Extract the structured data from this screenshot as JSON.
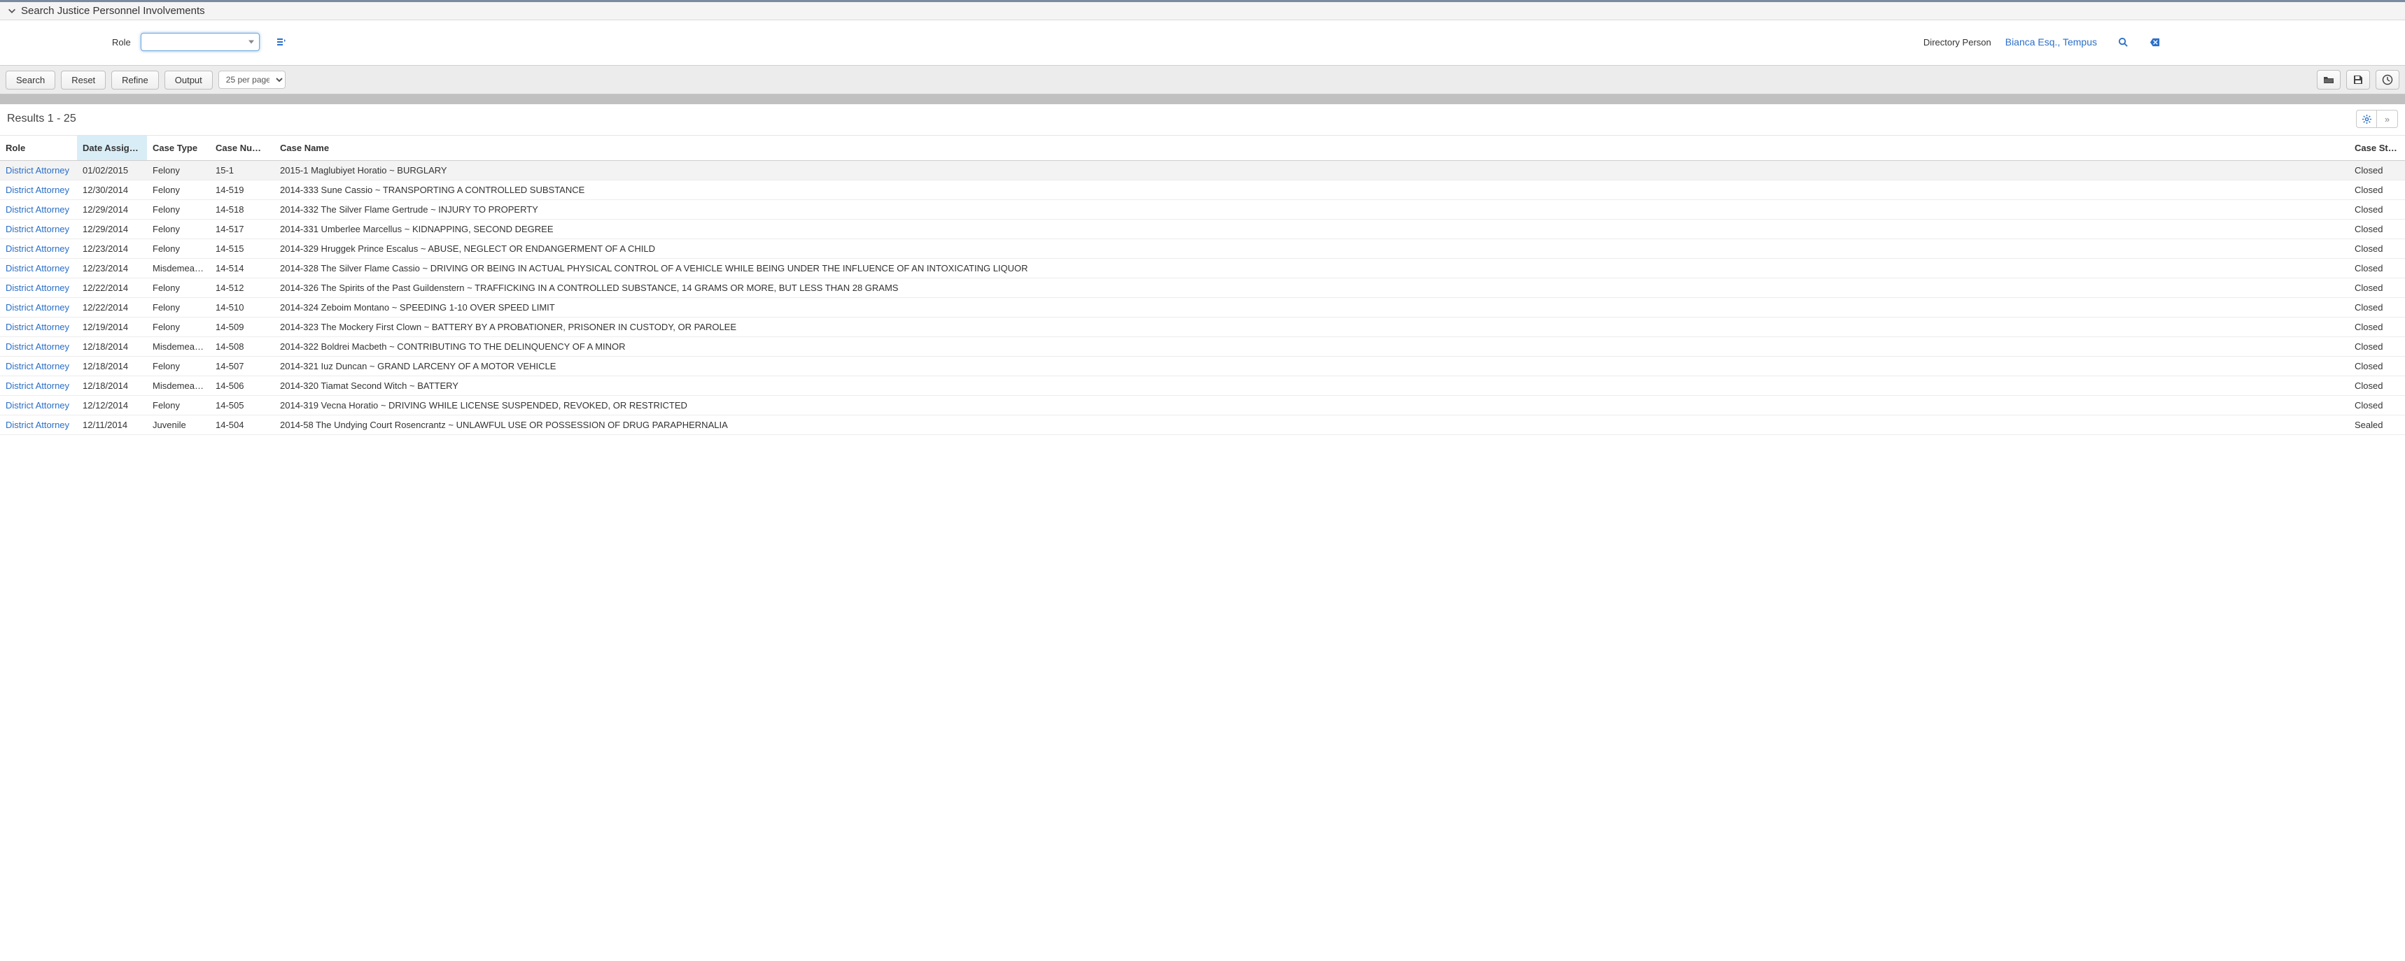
{
  "header": {
    "title": "Search Justice Personnel Involvements"
  },
  "form": {
    "role_label": "Role",
    "role_value": "",
    "directory_person_label": "Directory Person",
    "directory_person_value": "Bianca Esq., Tempus"
  },
  "toolbar": {
    "search": "Search",
    "reset": "Reset",
    "refine": "Refine",
    "output": "Output",
    "per_page": "25 per page"
  },
  "results_header": "Results 1 - 25",
  "columns": {
    "role": "Role",
    "date_assigned": "Date Assigned",
    "case_type": "Case Type",
    "case_number": "Case Number",
    "case_name": "Case Name",
    "case_status": "Case Status"
  },
  "sorted_column": "date_assigned",
  "rows": [
    {
      "role": "District Attorney",
      "date": "01/02/2015",
      "type": "Felony",
      "num": "15-1",
      "name": "2015-1 Maglubiyet Horatio ~ BURGLARY",
      "status": "Closed"
    },
    {
      "role": "District Attorney",
      "date": "12/30/2014",
      "type": "Felony",
      "num": "14-519",
      "name": "2014-333 Sune Cassio ~ TRANSPORTING A CONTROLLED SUBSTANCE",
      "status": "Closed"
    },
    {
      "role": "District Attorney",
      "date": "12/29/2014",
      "type": "Felony",
      "num": "14-518",
      "name": "2014-332 The Silver Flame Gertrude ~ INJURY TO PROPERTY",
      "status": "Closed"
    },
    {
      "role": "District Attorney",
      "date": "12/29/2014",
      "type": "Felony",
      "num": "14-517",
      "name": "2014-331 Umberlee Marcellus ~ KIDNAPPING, SECOND DEGREE",
      "status": "Closed"
    },
    {
      "role": "District Attorney",
      "date": "12/23/2014",
      "type": "Felony",
      "num": "14-515",
      "name": "2014-329 Hruggek Prince Escalus ~ ABUSE, NEGLECT OR ENDANGERMENT OF A CHILD",
      "status": "Closed"
    },
    {
      "role": "District Attorney",
      "date": "12/23/2014",
      "type": "Misdemeanor",
      "num": "14-514",
      "name": "2014-328 The Silver Flame Cassio ~ DRIVING OR BEING IN ACTUAL PHYSICAL CONTROL OF A VEHICLE WHILE BEING UNDER THE INFLUENCE OF AN INTOXICATING LIQUOR",
      "status": "Closed"
    },
    {
      "role": "District Attorney",
      "date": "12/22/2014",
      "type": "Felony",
      "num": "14-512",
      "name": "2014-326 The Spirits of the Past Guildenstern ~ TRAFFICKING IN A CONTROLLED SUBSTANCE, 14 GRAMS OR MORE, BUT LESS THAN 28 GRAMS",
      "status": "Closed"
    },
    {
      "role": "District Attorney",
      "date": "12/22/2014",
      "type": "Felony",
      "num": "14-510",
      "name": "2014-324 Zeboim Montano ~ SPEEDING 1-10 OVER SPEED LIMIT",
      "status": "Closed"
    },
    {
      "role": "District Attorney",
      "date": "12/19/2014",
      "type": "Felony",
      "num": "14-509",
      "name": "2014-323 The Mockery First Clown ~ BATTERY BY A PROBATIONER, PRISONER IN CUSTODY, OR PAROLEE",
      "status": "Closed"
    },
    {
      "role": "District Attorney",
      "date": "12/18/2014",
      "type": "Misdemeanor",
      "num": "14-508",
      "name": "2014-322 Boldrei Macbeth ~ CONTRIBUTING TO THE DELINQUENCY OF A MINOR",
      "status": "Closed"
    },
    {
      "role": "District Attorney",
      "date": "12/18/2014",
      "type": "Felony",
      "num": "14-507",
      "name": "2014-321 Iuz Duncan ~ GRAND LARCENY OF A MOTOR VEHICLE",
      "status": "Closed"
    },
    {
      "role": "District Attorney",
      "date": "12/18/2014",
      "type": "Misdemeanor",
      "num": "14-506",
      "name": "2014-320 Tiamat Second Witch ~ BATTERY",
      "status": "Closed"
    },
    {
      "role": "District Attorney",
      "date": "12/12/2014",
      "type": "Felony",
      "num": "14-505",
      "name": "2014-319 Vecna Horatio ~ DRIVING WHILE LICENSE SUSPENDED, REVOKED, OR RESTRICTED",
      "status": "Closed"
    },
    {
      "role": "District Attorney",
      "date": "12/11/2014",
      "type": "Juvenile",
      "num": "14-504",
      "name": "2014-58 The Undying Court Rosencrantz ~ UNLAWFUL USE OR POSSESSION OF DRUG PARAPHERNALIA",
      "status": "Sealed"
    }
  ]
}
